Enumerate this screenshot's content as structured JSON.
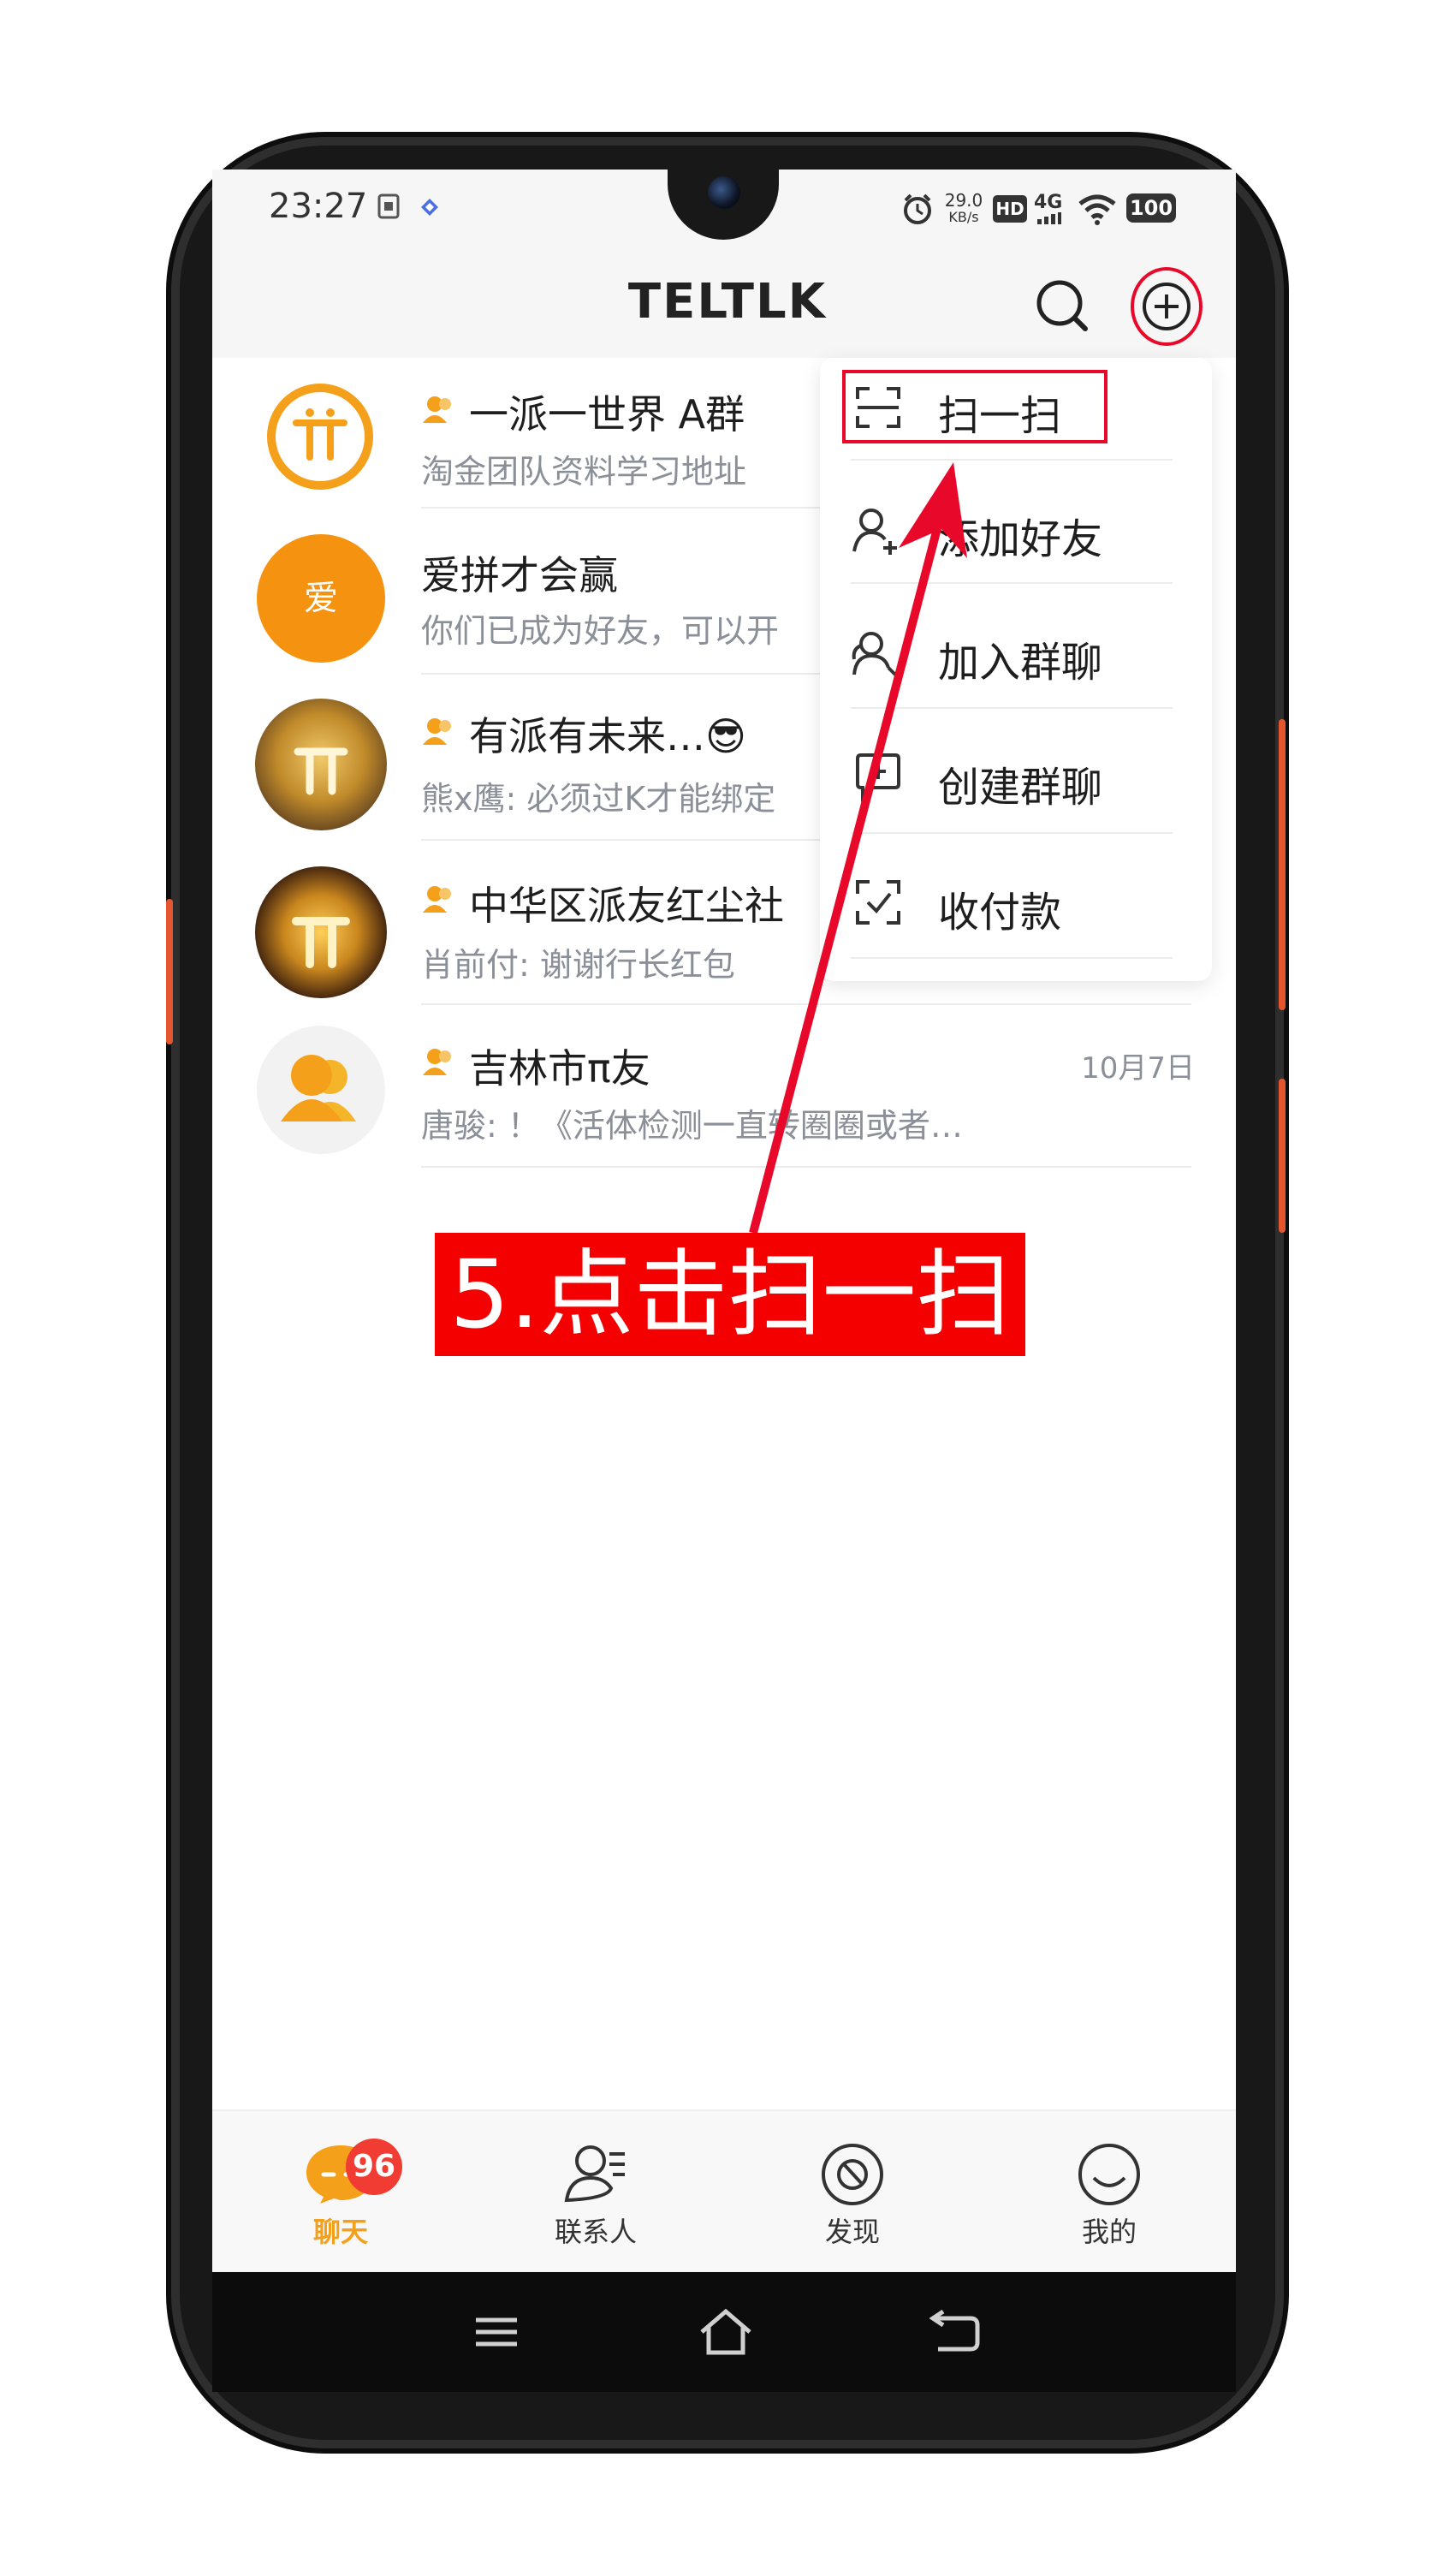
{
  "status_bar": {
    "time": "23:27",
    "speed": "29.0",
    "speed_unit": "KB/s",
    "hd": "HD",
    "network": "4G",
    "battery": "100"
  },
  "app_bar": {
    "title": "TELTLK"
  },
  "chats": [
    {
      "name": "一派一世界 A群",
      "preview": "淘金团队资料学习地址",
      "date": "",
      "avatar": "pi-logo"
    },
    {
      "name": "爱拼才会赢",
      "preview": "你们已成为好友，可以开",
      "date": "",
      "avatar_text": "爱"
    },
    {
      "name": "有派有未来…😎",
      "preview": "熊x鹰: 必须过K才能绑定",
      "date": "",
      "avatar": "gold-pi"
    },
    {
      "name": "中华区派友红尘社",
      "preview": "肖前付: 谢谢行长红包",
      "date": "",
      "avatar": "pi-network-coin"
    },
    {
      "name": "吉林市π友",
      "preview": "唐骏: ！《活体检测一直转圈圈或者…",
      "date": "10月7日",
      "avatar": "group-icon"
    }
  ],
  "menu": {
    "items": [
      {
        "label": "扫一扫",
        "icon": "scan-icon"
      },
      {
        "label": "添加好友",
        "icon": "add-friend-icon"
      },
      {
        "label": "加入群聊",
        "icon": "join-group-icon"
      },
      {
        "label": "创建群聊",
        "icon": "create-group-icon"
      },
      {
        "label": "收付款",
        "icon": "payment-icon"
      }
    ]
  },
  "tabs": [
    {
      "label": "聊天",
      "badge": "96",
      "active": true
    },
    {
      "label": "联系人"
    },
    {
      "label": "发现"
    },
    {
      "label": "我的"
    }
  ],
  "annotation": {
    "text": "5.点击扫一扫"
  },
  "colors": {
    "accent_orange": "#f5a01a",
    "annotation_red": "#e8082a",
    "badge_red": "#f03c32"
  }
}
